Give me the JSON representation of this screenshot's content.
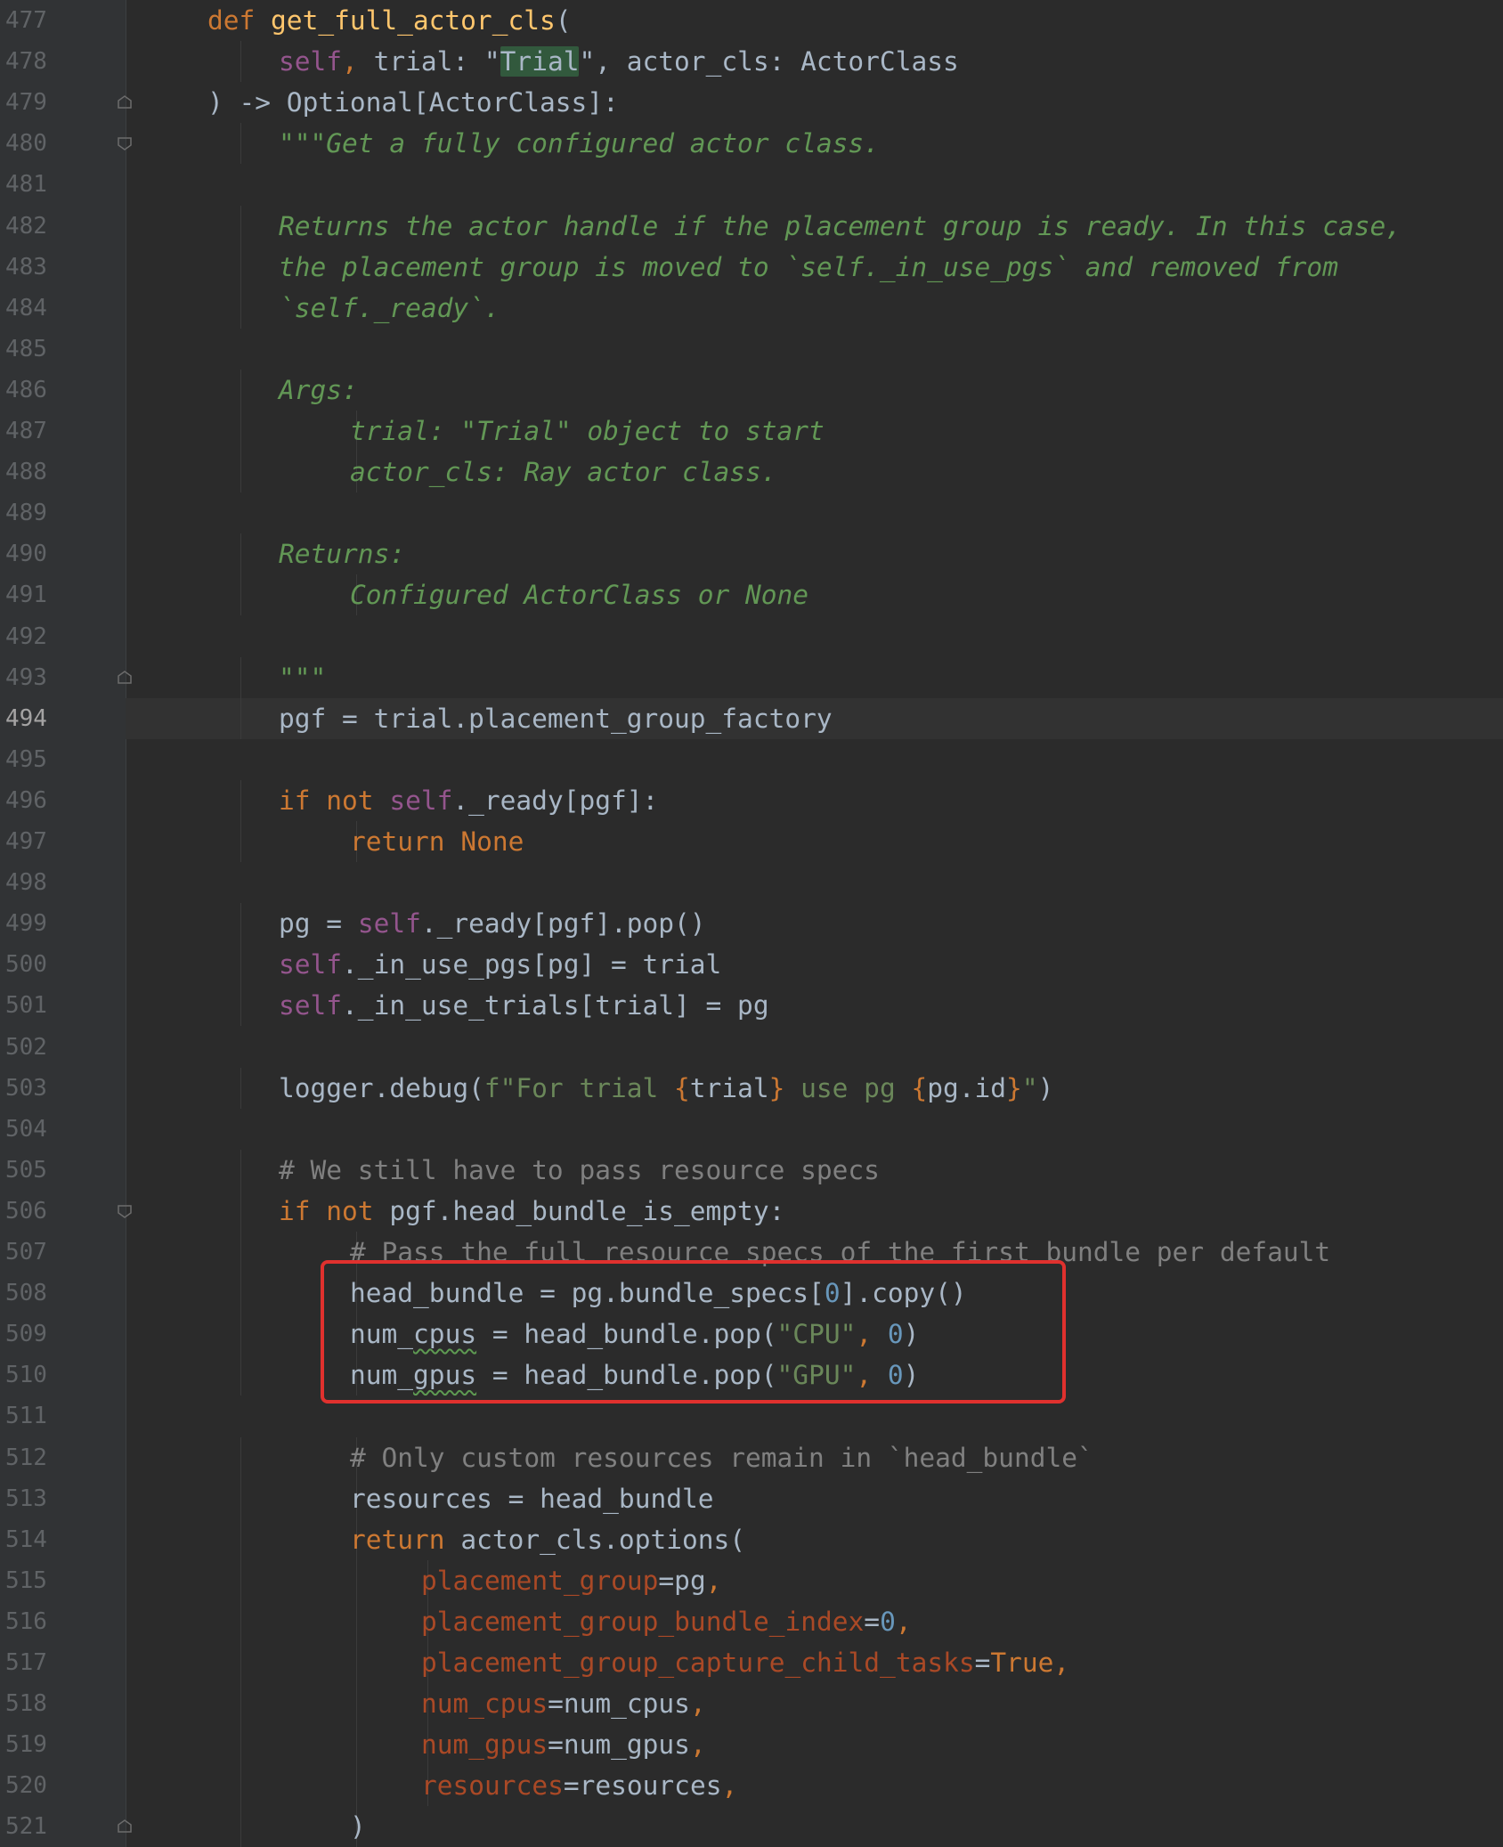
{
  "editor": {
    "highlight_color": "#e0312e",
    "current_line": "494",
    "lines": [
      {
        "n": "477",
        "indent": 2,
        "tokens": [
          [
            "kw",
            "def "
          ],
          [
            "fn",
            "get_full_actor_cls"
          ],
          [
            "id",
            "("
          ]
        ]
      },
      {
        "n": "478",
        "indent": 3,
        "tokens": [
          [
            "slf",
            "self"
          ],
          [
            "kw",
            ", "
          ],
          [
            "id",
            "trial: "
          ],
          [
            "id",
            "\""
          ],
          [
            "match",
            "Trial"
          ],
          [
            "id",
            "\", actor_cls: ActorClass"
          ]
        ]
      },
      {
        "n": "479",
        "indent": 2,
        "tokens": [
          [
            "id",
            ") -> Optional[ActorClass]:"
          ]
        ]
      },
      {
        "n": "480",
        "indent": 3,
        "tokens": [
          [
            "doc",
            "\"\"\"Get a fully configured actor class."
          ]
        ]
      },
      {
        "n": "481",
        "indent": 0,
        "tokens": []
      },
      {
        "n": "482",
        "indent": 3,
        "tokens": [
          [
            "doc",
            "Returns the actor handle if the placement group is ready. In this case,"
          ]
        ]
      },
      {
        "n": "483",
        "indent": 3,
        "tokens": [
          [
            "doc",
            "the placement group is moved to `self._in_use_pgs` and removed from"
          ]
        ]
      },
      {
        "n": "484",
        "indent": 3,
        "tokens": [
          [
            "doc",
            "`self._ready`."
          ]
        ]
      },
      {
        "n": "485",
        "indent": 0,
        "tokens": []
      },
      {
        "n": "486",
        "indent": 3,
        "tokens": [
          [
            "doc",
            "Args:"
          ]
        ]
      },
      {
        "n": "487",
        "indent": 4,
        "tokens": [
          [
            "doc",
            "trial: \"Trial\" object to start"
          ]
        ]
      },
      {
        "n": "488",
        "indent": 4,
        "tokens": [
          [
            "doc",
            "actor_cls: Ray actor class."
          ]
        ]
      },
      {
        "n": "489",
        "indent": 0,
        "tokens": []
      },
      {
        "n": "490",
        "indent": 3,
        "tokens": [
          [
            "doc",
            "Returns:"
          ]
        ]
      },
      {
        "n": "491",
        "indent": 4,
        "tokens": [
          [
            "doc",
            "Configured ActorClass or None"
          ]
        ]
      },
      {
        "n": "492",
        "indent": 0,
        "tokens": []
      },
      {
        "n": "493",
        "indent": 3,
        "tokens": [
          [
            "doc",
            "\"\"\""
          ]
        ]
      },
      {
        "n": "494",
        "indent": 3,
        "tokens": [
          [
            "id",
            "pgf = trial.placement_group_factory"
          ]
        ]
      },
      {
        "n": "495",
        "indent": 0,
        "tokens": []
      },
      {
        "n": "496",
        "indent": 3,
        "tokens": [
          [
            "kw",
            "if not "
          ],
          [
            "slf",
            "self"
          ],
          [
            "id",
            "._ready[pgf]:"
          ]
        ]
      },
      {
        "n": "497",
        "indent": 4,
        "tokens": [
          [
            "kw",
            "return None"
          ]
        ]
      },
      {
        "n": "498",
        "indent": 0,
        "tokens": []
      },
      {
        "n": "499",
        "indent": 3,
        "tokens": [
          [
            "id",
            "pg = "
          ],
          [
            "slf",
            "self"
          ],
          [
            "id",
            "._ready[pgf].pop()"
          ]
        ]
      },
      {
        "n": "500",
        "indent": 3,
        "tokens": [
          [
            "slf",
            "self"
          ],
          [
            "id",
            "._in_use_pgs[pg] = trial"
          ]
        ]
      },
      {
        "n": "501",
        "indent": 3,
        "tokens": [
          [
            "slf",
            "self"
          ],
          [
            "id",
            "._in_use_trials[trial] = pg"
          ]
        ]
      },
      {
        "n": "502",
        "indent": 0,
        "tokens": []
      },
      {
        "n": "503",
        "indent": 3,
        "tokens": [
          [
            "id",
            "logger.debug("
          ],
          [
            "str",
            "f\"For trial "
          ],
          [
            "kw",
            "{"
          ],
          [
            "id",
            "trial"
          ],
          [
            "kw",
            "}"
          ],
          [
            "str",
            " use pg "
          ],
          [
            "kw",
            "{"
          ],
          [
            "id",
            "pg.id"
          ],
          [
            "kw",
            "}"
          ],
          [
            "str",
            "\""
          ],
          [
            "id",
            ")"
          ]
        ]
      },
      {
        "n": "504",
        "indent": 0,
        "tokens": []
      },
      {
        "n": "505",
        "indent": 3,
        "tokens": [
          [
            "cmt",
            "# We still have to pass resource specs"
          ]
        ]
      },
      {
        "n": "506",
        "indent": 3,
        "tokens": [
          [
            "kw",
            "if not "
          ],
          [
            "id",
            "pgf.head_bundle_is_empty:"
          ]
        ]
      },
      {
        "n": "507",
        "indent": 4,
        "tokens": [
          [
            "cmt",
            "# Pass the full resource specs of the first bundle per default"
          ]
        ]
      },
      {
        "n": "508",
        "indent": 4,
        "tokens": [
          [
            "id",
            "head_bundle = pg.bundle_specs["
          ],
          [
            "num",
            "0"
          ],
          [
            "id",
            "].copy()"
          ]
        ]
      },
      {
        "n": "509",
        "indent": 4,
        "tokens": [
          [
            "id",
            "num_"
          ],
          [
            "squig",
            "cpus"
          ],
          [
            "id",
            " = head_bundle.pop("
          ],
          [
            "str",
            "\"CPU\""
          ],
          [
            "kw",
            ", "
          ],
          [
            "num",
            "0"
          ],
          [
            "id",
            ")"
          ]
        ]
      },
      {
        "n": "510",
        "indent": 4,
        "tokens": [
          [
            "id",
            "num_"
          ],
          [
            "squig",
            "gpus"
          ],
          [
            "id",
            " = head_bundle.pop("
          ],
          [
            "str",
            "\"GPU\""
          ],
          [
            "kw",
            ", "
          ],
          [
            "num",
            "0"
          ],
          [
            "id",
            ")"
          ]
        ]
      },
      {
        "n": "511",
        "indent": 0,
        "tokens": []
      },
      {
        "n": "512",
        "indent": 4,
        "tokens": [
          [
            "cmt",
            "# Only custom resources remain in `head_bundle`"
          ]
        ]
      },
      {
        "n": "513",
        "indent": 4,
        "tokens": [
          [
            "id",
            "resources = head_bundle"
          ]
        ]
      },
      {
        "n": "514",
        "indent": 4,
        "tokens": [
          [
            "kw",
            "return "
          ],
          [
            "id",
            "actor_cls.options("
          ]
        ]
      },
      {
        "n": "515",
        "indent": 5,
        "tokens": [
          [
            "prm",
            "placement_group"
          ],
          [
            "id",
            "=pg"
          ],
          [
            "kw",
            ","
          ]
        ]
      },
      {
        "n": "516",
        "indent": 5,
        "tokens": [
          [
            "prm",
            "placement_group_bundle_index"
          ],
          [
            "id",
            "="
          ],
          [
            "num",
            "0"
          ],
          [
            "kw",
            ","
          ]
        ]
      },
      {
        "n": "517",
        "indent": 5,
        "tokens": [
          [
            "prm",
            "placement_group_capture_child_tasks"
          ],
          [
            "id",
            "="
          ],
          [
            "kw",
            "True,"
          ]
        ]
      },
      {
        "n": "518",
        "indent": 5,
        "tokens": [
          [
            "prm",
            "num_cpus"
          ],
          [
            "id",
            "=num_cpus"
          ],
          [
            "kw",
            ","
          ]
        ]
      },
      {
        "n": "519",
        "indent": 5,
        "tokens": [
          [
            "prm",
            "num_gpus"
          ],
          [
            "id",
            "=num_gpus"
          ],
          [
            "kw",
            ","
          ]
        ]
      },
      {
        "n": "520",
        "indent": 5,
        "tokens": [
          [
            "prm",
            "resources"
          ],
          [
            "id",
            "=resources"
          ],
          [
            "kw",
            ","
          ]
        ]
      },
      {
        "n": "521",
        "indent": 4,
        "tokens": [
          [
            "id",
            ")"
          ]
        ]
      }
    ]
  }
}
